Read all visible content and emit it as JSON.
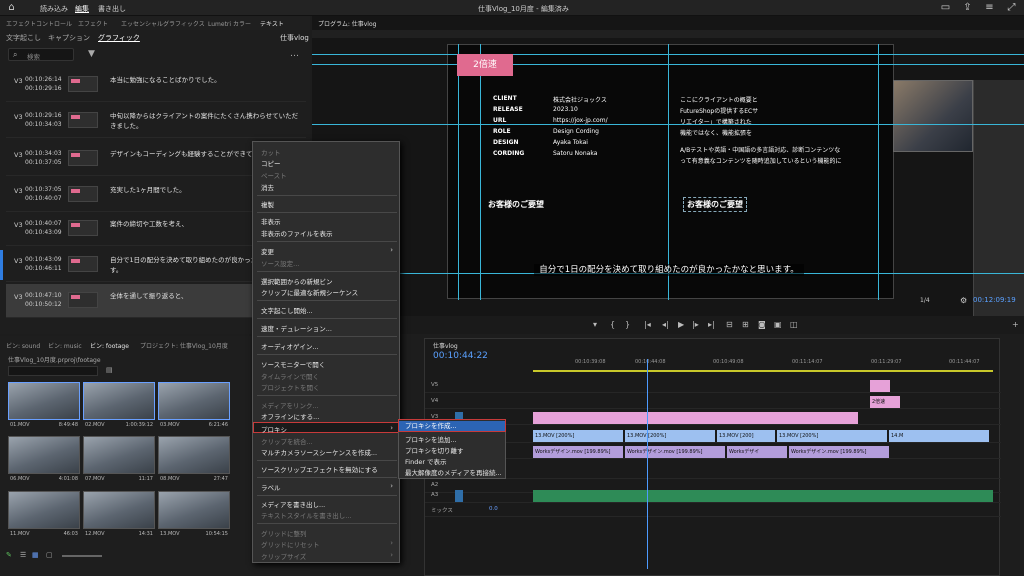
{
  "topbar": {
    "nav": [
      "読み込み",
      "編集",
      "書き出し"
    ],
    "title": "仕事Vlog_10月度 - 編集済み"
  },
  "panel_tabs": [
    "エフェクトコントロール",
    "エフェクト",
    "エッセンシャルグラフィックス",
    "Lumetri カラー",
    "テキスト",
    "プログラム: 仕事vlog"
  ],
  "text_panel": {
    "subtabs": [
      "文字起こし",
      "キャプション",
      "グラフィック"
    ],
    "sequence": "仕事vlog",
    "search_placeholder": "検索",
    "captions": [
      {
        "track": "V3",
        "in": "00:10:26:14",
        "out": "00:10:29:16",
        "text": "本当に勉強になることばかりでした。"
      },
      {
        "track": "V3",
        "in": "00:10:29:16",
        "out": "00:10:34:03",
        "text": "中旬以降からはクライアントの案件にたくさん携わらせていただきました。"
      },
      {
        "track": "V3",
        "in": "00:10:34:03",
        "out": "00:10:37:05",
        "text": "デザインもコーディングも経験することができて、"
      },
      {
        "track": "V3",
        "in": "00:10:37:05",
        "out": "00:10:40:07",
        "text": "充実した1ヶ月間でした。"
      },
      {
        "track": "V3",
        "in": "00:10:40:07",
        "out": "00:10:43:09",
        "text": "案件の締切や工数を考え、"
      },
      {
        "track": "V3",
        "in": "00:10:43:09",
        "out": "00:10:46:11",
        "text": "自分で1日の配分を決めて取り組めたのが良かったかなと思います。"
      },
      {
        "track": "V3",
        "in": "00:10:47:10",
        "out": "00:10:50:12",
        "text": "全体を通して振り返ると、"
      }
    ]
  },
  "program": {
    "speed_tag": "2倍速",
    "specs": [
      {
        "k": "CLIENT",
        "v": "株式会社ジョックス"
      },
      {
        "k": "RELEASE",
        "v": "2023.10"
      },
      {
        "k": "URL",
        "v": "https://jox-jp.com/"
      },
      {
        "k": "ROLE",
        "v": "Design Cording"
      },
      {
        "k": "DESIGN",
        "v": "Ayaka Tokai"
      },
      {
        "k": "CORDING",
        "v": "Satoru Nonaka"
      }
    ],
    "body_lines": [
      "ここにクライアントの概要と",
      "FutureShopの提供するECサ",
      "リエイター」で構築された",
      "機能ではなく、機能拡張を",
      "A/Bテストや英語・中国語の多言語対応、診断コンテンツな",
      "って有意義なコンテンツを随時追加しているという機能的に"
    ],
    "heading_left": "お客様のご要望",
    "heading_right": "お客様のご要望",
    "caption": "自分で1日の配分を決めて取り組めたのが良かったかなと思います。",
    "zoom": "1/4",
    "timecode": "00:12:09:19"
  },
  "bins": {
    "tabs": [
      "ビン: sound",
      "ビン: music",
      "ビン: footage",
      "プロジェクト: 仕事Vlog_10月度"
    ],
    "path": "仕事Vlog_10月度.prproj\\footage",
    "clips": [
      {
        "name": "01.MOV",
        "dur": "8:49:48"
      },
      {
        "name": "02.MOV",
        "dur": "1:00:39:12"
      },
      {
        "name": "03.MOV",
        "dur": "6:21:46"
      },
      {
        "name": "06.MOV",
        "dur": "4:01:08"
      },
      {
        "name": "07.MOV",
        "dur": "11:17"
      },
      {
        "name": "08.MOV",
        "dur": "27:47"
      },
      {
        "name": "11.MOV",
        "dur": "46:03"
      },
      {
        "name": "12.MOV",
        "dur": "14:31"
      },
      {
        "name": "13.MOV",
        "dur": "10:54:15"
      }
    ]
  },
  "timeline": {
    "sequence": "仕事vlog",
    "timecode": "00:10:44:22",
    "ruler": [
      "00:10:39:08",
      "00:10:44:08",
      "00:10:49:08",
      "00:11:14:07",
      "00:11:29:07",
      "00:11:44:07"
    ],
    "tracks": [
      "V5",
      "V4",
      "V3",
      "V2",
      "V1",
      "A1",
      "A2",
      "A3",
      "ミックス"
    ],
    "v4_label": "2倍速",
    "v2_clips": [
      "13.MOV [200%]",
      "13.MOV [200%]",
      "13.MOV [200]",
      "13.MOV [200%]",
      "14.M"
    ],
    "v1_clips": [
      "Worksデザイン.mov [199.89%]",
      "Worksデザイン.mov [199.89%]",
      "Worksデザイ",
      "Worksデザイン.mov [199.89%]"
    ],
    "mix_value": "0.0"
  },
  "context_menu": {
    "items": [
      {
        "label": "カット",
        "enabled": false
      },
      {
        "label": "コピー",
        "enabled": true
      },
      {
        "label": "ペースト",
        "enabled": false
      },
      {
        "label": "消去",
        "enabled": true
      },
      {
        "label": "複製",
        "enabled": true
      },
      {
        "label": "非表示",
        "enabled": true
      },
      {
        "label": "非表示のファイルを表示",
        "enabled": true
      },
      {
        "label": "変更",
        "enabled": true,
        "submenu": true
      },
      {
        "label": "ソース設定...",
        "enabled": false
      },
      {
        "label": "選択範囲からの新規ビン",
        "enabled": true
      },
      {
        "label": "クリップに最適な新規シーケンス",
        "enabled": true
      },
      {
        "label": "文字起こし開始...",
        "enabled": true
      },
      {
        "label": "速度・デュレーション...",
        "enabled": true
      },
      {
        "label": "オーディオゲイン...",
        "enabled": true
      },
      {
        "label": "ソースモニターで開く",
        "enabled": true
      },
      {
        "label": "タイムラインで開く",
        "enabled": false
      },
      {
        "label": "プロジェクトを開く",
        "enabled": false
      },
      {
        "label": "メディアをリンク...",
        "enabled": false
      },
      {
        "label": "オフラインにする...",
        "enabled": true
      },
      {
        "label": "プロキシ",
        "enabled": true,
        "submenu": true
      },
      {
        "label": "クリップを統合...",
        "enabled": false
      },
      {
        "label": "マルチカメラソースシーケンスを作成...",
        "enabled": true
      },
      {
        "label": "ソースクリップエフェクトを無効にする",
        "enabled": true
      },
      {
        "label": "ラベル",
        "enabled": true,
        "submenu": true
      },
      {
        "label": "メディアを書き出し...",
        "enabled": true
      },
      {
        "label": "テキストスタイルを書き出し...",
        "enabled": false
      },
      {
        "label": "グリッドに整列",
        "enabled": false
      },
      {
        "label": "グリッドにリセット",
        "enabled": false,
        "submenu": true
      },
      {
        "label": "クリップサイズ",
        "enabled": false,
        "submenu": true
      }
    ]
  },
  "proxy_submenu": {
    "items": [
      "プロキシを作成...",
      "プロキシを追加...",
      "プロキシを切り離す",
      "Finder で表示",
      "最大解像度のメディアを再接続..."
    ]
  }
}
